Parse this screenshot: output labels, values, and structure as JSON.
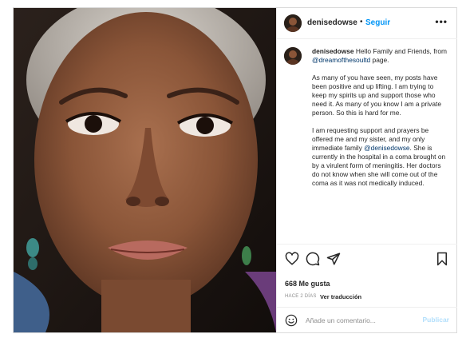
{
  "post": {
    "username": "denisedowse",
    "follow_label": "Seguir",
    "separator": "•",
    "more_label": "•••",
    "photo_alt": "Portrait photo of a smiling woman with short gray hair"
  },
  "caption": {
    "username": "denisedowse",
    "intro": "Hello Family and Friends, from ",
    "intro_mention": "@dreamofthesoultd",
    "intro_end": " page.",
    "paragraph_2": "As many of you have seen, my posts have been positive and up lifting. I am trying to keep my spirits up and support those who need it. As many of you know I am a private person. So this is hard for me.",
    "paragraph_3_start": "I am requesting support and prayers be offered me and my sister, and my only immediate family ",
    "paragraph_3_mention": "@denisedowse",
    "paragraph_3_end": ". She is currently in the hospital in a coma brought on by a virulent form of meningitis. Her doctors do not know when she will come out of the coma as it was not medically induced."
  },
  "engagement": {
    "likes": "668 Me gusta",
    "time_ago": "HACE 2 DÍAS",
    "translate_label": "Ver traducción"
  },
  "comment": {
    "placeholder": "Añade un comentario...",
    "publish_label": "Publicar"
  },
  "colors": {
    "link_blue": "#0095f6",
    "mention_blue": "#00376b",
    "publish_disabled": "#b2dffc",
    "border": "#dbdbdb"
  },
  "icons": [
    "heart-icon",
    "comment-icon",
    "share-icon",
    "bookmark-icon",
    "emoji-icon"
  ]
}
